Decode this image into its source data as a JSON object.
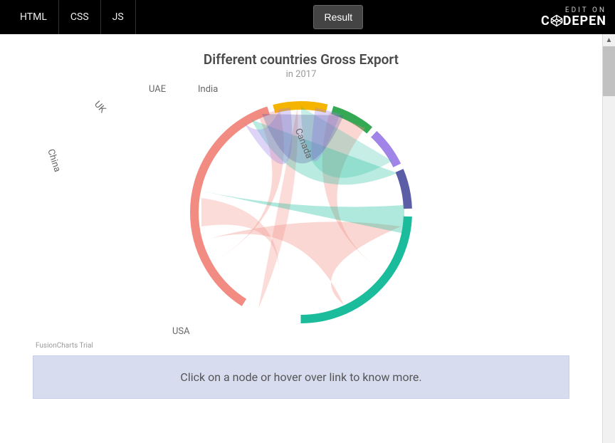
{
  "topbar": {
    "tabs": {
      "html": "HTML",
      "css": "CSS",
      "js": "JS"
    },
    "result_label": "Result",
    "brand_top": "EDIT ON",
    "brand_bottom": "C   DEPEN"
  },
  "title": "Different countries Gross Export",
  "subtitle": "in 2017",
  "hint": "Click on a node or hover over link to know more.",
  "trial_text": "FusionCharts Trial",
  "chart_data": {
    "type": "chord",
    "nodes": [
      {
        "name": "USA",
        "color": "#f28b82",
        "arc_degrees": 140
      },
      {
        "name": "China",
        "color": "#f4b400",
        "arc_degrees": 35
      },
      {
        "name": "UK",
        "color": "#34a853",
        "arc_degrees": 30
      },
      {
        "name": "UAE",
        "color": "#a084e8",
        "arc_degrees": 25
      },
      {
        "name": "India",
        "color": "#5b5ea6",
        "arc_degrees": 25
      },
      {
        "name": "Canada",
        "color": "#1abc9c",
        "arc_degrees": 95
      }
    ],
    "links": [
      {
        "from": "USA",
        "to": "Canada",
        "value_estimate": 60,
        "color": "#f28b82"
      },
      {
        "from": "USA",
        "to": "India",
        "value_estimate": 40,
        "color": "#f28b82"
      },
      {
        "from": "USA",
        "to": "UAE",
        "value_estimate": 25,
        "color": "#f28b82"
      },
      {
        "from": "USA",
        "to": "UK",
        "value_estimate": 25,
        "color": "#f28b82"
      },
      {
        "from": "USA",
        "to": "China",
        "value_estimate": 35,
        "color": "#f28b82"
      },
      {
        "from": "Canada",
        "to": "China",
        "value_estimate": 30,
        "color": "#1abc9c"
      },
      {
        "from": "Canada",
        "to": "UK",
        "value_estimate": 15,
        "color": "#1abc9c"
      },
      {
        "from": "Canada",
        "to": "UAE",
        "value_estimate": 15,
        "color": "#1abc9c"
      },
      {
        "from": "UAE",
        "to": "UK",
        "value_estimate": 20,
        "color": "#a084e8"
      },
      {
        "from": "UAE",
        "to": "India",
        "value_estimate": 15,
        "color": "#a084e8"
      },
      {
        "from": "India",
        "to": "UK",
        "value_estimate": 10,
        "color": "#5b5ea6"
      }
    ]
  }
}
